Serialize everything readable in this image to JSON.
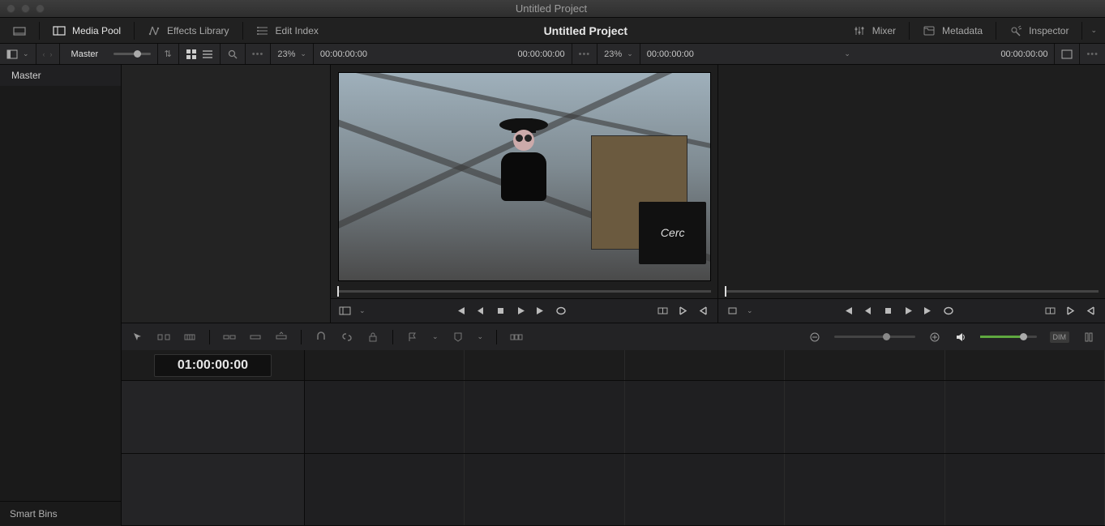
{
  "window": {
    "title": "Untitled Project"
  },
  "toolbar": {
    "media_pool": "Media Pool",
    "effects_library": "Effects Library",
    "edit_index": "Edit Index",
    "project_title": "Untitled Project",
    "mixer": "Mixer",
    "metadata": "Metadata",
    "inspector": "Inspector"
  },
  "subbar": {
    "bin_label": "Master",
    "left_zoom": "23%",
    "left_tc_in": "00:00:00:00",
    "left_tc_out": "00:00:00:00",
    "right_zoom": "23%",
    "right_tc_in": "00:00:00:00",
    "right_tc_out": "00:00:00:00"
  },
  "sidebar": {
    "items": [
      "Master"
    ],
    "smart_bins": "Smart Bins"
  },
  "timeline": {
    "timecode": "01:00:00:00"
  },
  "tools": {
    "dim_label": "DIM"
  },
  "preview": {
    "banner_text": "Cerc"
  }
}
